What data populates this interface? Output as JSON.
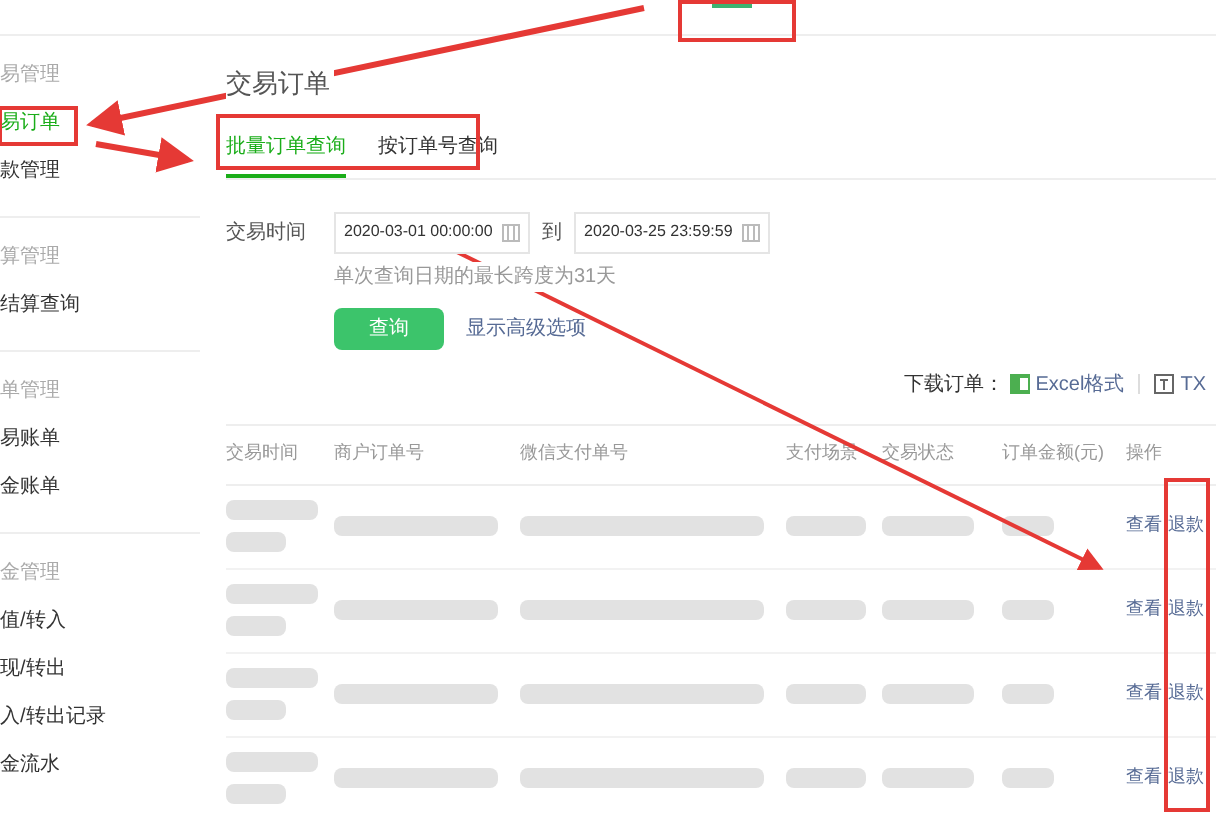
{
  "sidebar": {
    "groups": [
      {
        "header": "易管理",
        "items": [
          {
            "label": "易订单",
            "selected": true
          },
          {
            "label": "款管理",
            "selected": false
          }
        ]
      },
      {
        "header": "算管理",
        "items": [
          {
            "label": "结算查询",
            "selected": false
          }
        ]
      },
      {
        "header": "单管理",
        "items": [
          {
            "label": "易账单",
            "selected": false
          },
          {
            "label": "金账单",
            "selected": false
          }
        ]
      },
      {
        "header": "金管理",
        "items": [
          {
            "label": "值/转入",
            "selected": false
          },
          {
            "label": "现/转出",
            "selected": false
          },
          {
            "label": "入/转出记录",
            "selected": false
          },
          {
            "label": "金流水",
            "selected": false
          }
        ]
      }
    ]
  },
  "page_title": "交易订单",
  "tabs": [
    {
      "label": "批量订单查询",
      "selected": true
    },
    {
      "label": "按订单号查询",
      "selected": false
    }
  ],
  "form": {
    "label": "交易时间",
    "start": "2020-03-01 00:00:00",
    "separator": "到",
    "end": "2020-03-25 23:59:59",
    "hint": "单次查询日期的最长跨度为31天",
    "submit": "查询",
    "advanced_link": "显示高级选项"
  },
  "download": {
    "label": "下载订单：",
    "formats": [
      {
        "kind": "excel",
        "label": "Excel格式"
      },
      {
        "kind": "txt",
        "label": "TX"
      }
    ]
  },
  "table": {
    "columns": [
      "交易时间",
      "商户订单号",
      "微信支付单号",
      "支付场景",
      "交易状态",
      "订单金额(元)",
      "操作"
    ],
    "rows": [
      {
        "actions": [
          "查看",
          "退款"
        ]
      },
      {
        "actions": [
          "查看",
          "退款"
        ]
      },
      {
        "actions": [
          "查看",
          "退款"
        ]
      },
      {
        "actions": [
          "查看",
          "退款"
        ]
      }
    ]
  }
}
